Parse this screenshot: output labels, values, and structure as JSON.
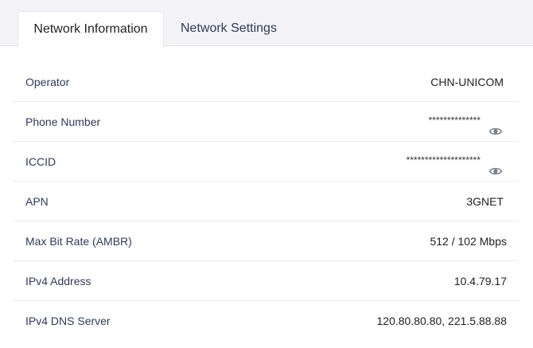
{
  "tabs": [
    {
      "label": "Network Information",
      "active": true
    },
    {
      "label": "Network Settings",
      "active": false
    }
  ],
  "rows": [
    {
      "label": "Operator",
      "value": "CHN-UNICOM"
    },
    {
      "label": "Phone Number",
      "value": "**************",
      "masked": true,
      "icon": "eye-icon"
    },
    {
      "label": "ICCID",
      "value": "********************",
      "masked": true,
      "icon": "eye-icon"
    },
    {
      "label": "APN",
      "value": "3GNET"
    },
    {
      "label": "Max Bit Rate (AMBR)",
      "value": "512 / 102 Mbps"
    },
    {
      "label": "IPv4 Address",
      "value": "10.4.79.17"
    },
    {
      "label": "IPv4 DNS Server",
      "value": "120.80.80.80, 221.5.88.88"
    }
  ],
  "colors": {
    "tabbar_bg": "#f4f4f6",
    "label_text": "#2f3a57",
    "value_text": "#222222",
    "divider": "#ebebee",
    "icon": "#7a7f8a"
  }
}
